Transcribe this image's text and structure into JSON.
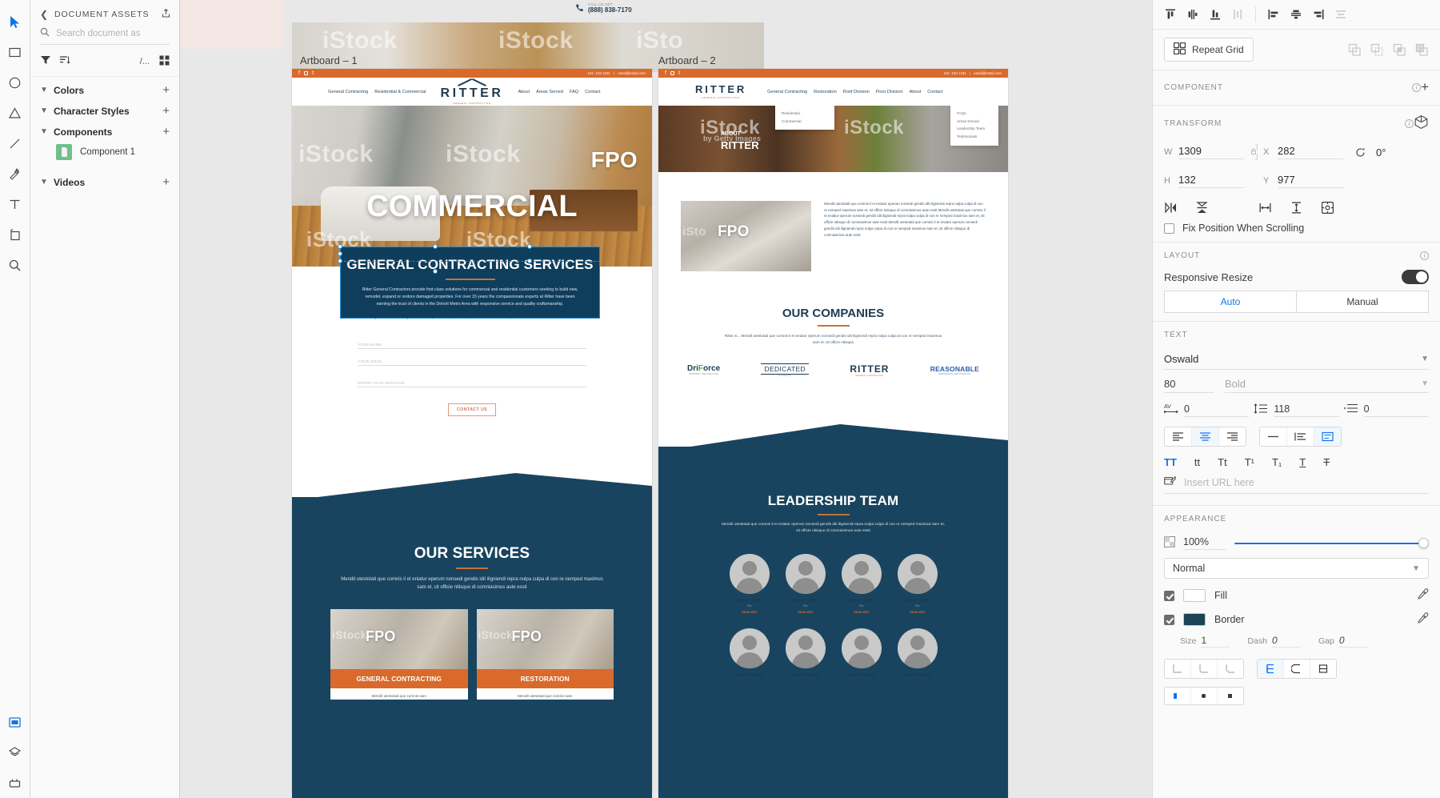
{
  "toolbar": {
    "tools": [
      {
        "name": "select-tool",
        "icon": "cursor-icon",
        "active": true
      },
      {
        "name": "rectangle-tool",
        "icon": "rectangle-icon",
        "active": false
      },
      {
        "name": "ellipse-tool",
        "icon": "ellipse-icon",
        "active": false
      },
      {
        "name": "polygon-tool",
        "icon": "triangle-icon",
        "active": false
      },
      {
        "name": "line-tool",
        "icon": "line-icon",
        "active": false
      },
      {
        "name": "pen-tool",
        "icon": "pen-icon",
        "active": false
      },
      {
        "name": "text-tool",
        "icon": "text-icon",
        "active": false
      },
      {
        "name": "artboard-tool",
        "icon": "artboard-icon",
        "active": false
      },
      {
        "name": "zoom-tool",
        "icon": "magnifier-icon",
        "active": false
      }
    ],
    "bottom": [
      {
        "name": "assets-panel-toggle",
        "icon": "assets-icon",
        "active": true
      },
      {
        "name": "layers-panel-toggle",
        "icon": "layers-icon",
        "active": false
      },
      {
        "name": "plugins-panel-toggle",
        "icon": "plugin-icon",
        "active": false
      }
    ]
  },
  "assets": {
    "title": "DOCUMENT ASSETS",
    "back_icon": "chevron-left-icon",
    "share_icon": "share-icon",
    "search_placeholder": "Search document as",
    "search_value": "",
    "filter_icon": "filter-icon",
    "sort_icon": "sort-icon",
    "view_mode_text": "/...",
    "grid_icon": "grid-view-icon",
    "groups": [
      {
        "label": "Colors",
        "expanded": true,
        "add": "+"
      },
      {
        "label": "Character Styles",
        "expanded": true,
        "add": "+"
      },
      {
        "label": "Components",
        "expanded": true,
        "add": "+"
      },
      {
        "label": "Videos",
        "expanded": true,
        "add": "+"
      }
    ],
    "component_item": "Component 1"
  },
  "canvas": {
    "artboard1": {
      "label": "Artboard – 1",
      "topbar": {
        "phone": "123 -123 1234",
        "sep": "|",
        "email": "email@email.com"
      },
      "nav_left": [
        "General Contracting",
        "Residential & Commercial"
      ],
      "brand": "RITTER",
      "brand_sub": "GENERAL CONTRACTING",
      "nav_right": [
        "About",
        "Areas Served",
        "FAQ",
        "Contact"
      ],
      "hero_title": "COMMERCIAL",
      "selected_box": {
        "title": "GENERAL CONTRACTING SERVICES",
        "body": "Ritter General Contractors provide first-class solutions for commercial and residential customers seeking to build new, remodel, expand or restore damaged properties. For over 15 years the compassionate experts at Ritter have been earning the trust of clients in the Detroit Metro Area with responsive service and quality craftsmanship."
      },
      "form": {
        "intro": "Ritter Contact Us Form Mendit utestotati que comnis il et eniatur eperum nonsedi gendis idit iligniendi repra nulpa culpa di con re nemped maximus sam et, s",
        "fields": [
          "YOUR NAME",
          "YOUR EMAIL",
          "ENTER YOUR MESSAGE"
        ],
        "button": "CONTACT US"
      },
      "services": {
        "title": "OUR SERVICES",
        "body": "Mendit utestotati que comnis il et eniatur eperum nonsedi gendis idit iligniendi repra nulpa culpa di con re nemped maximus sam et, sit officie ntiisquo di comniasimus aute essit",
        "cards": [
          {
            "label": "GENERAL CONTRACTING",
            "blurb": "Mendit utestotati que comnis sam",
            "fpo": "FPO"
          },
          {
            "label": "RESTORATION",
            "blurb": "Mendit utestotati que comnis sam",
            "fpo": "FPO"
          }
        ]
      },
      "fpo": "FPO"
    },
    "artboard2": {
      "label": "Artboard – 2",
      "topbar": {
        "phone": "123 -123 1234",
        "sep": "|",
        "email": "email@email.com"
      },
      "brand": "RITTER",
      "brand_sub": "GENERAL CONTRACTING",
      "nav": [
        "General Contracting",
        "Restoration",
        "Roof Division",
        "Floor Division",
        "About",
        "Contact"
      ],
      "dropdown_left": [
        "Residential",
        "Commercial"
      ],
      "dropdown_right": [
        "FAQs",
        "Areas Served",
        "Leadership Team",
        "Testimonials"
      ],
      "hero_kicker": "ABOUT",
      "hero_title": "RITTER",
      "about_body": "Mendit utestotati que comnis il et eniatur eperum nonsedi gendis idit iligniendi repra nulpa culpa di con re nemped maximus sam et, sit officie ntiisquo di comniasimus aute essit Mendit utestotati que comnis il et eniatur eperum nonsedi gendis idit iligniendi repra nulpa culpa di con re nemped maximus sam et, sit officie ntiisquo di comniasimus aute essit Mendit utestotati que comnis il et eniatur eperum nonsedi gendis idit iligniendi repra nulpa culpa di con re nemped maximus sam et, sit officie ntiisquo di comniasimus aute essit",
      "companies": {
        "title": "OUR COMPANIES",
        "body": "Ritter is... Mendit utestotati que comnis il et eniatur eperum nonsedi gendis idit iligniendi repra nulpa culpa di con re nemped maximus sam et, sit officie ntiisquo",
        "logos": [
          "DriForce",
          "DEDICATED",
          "RITTER",
          "REASONABLE"
        ],
        "logo_subs": [
          "PROPERTY RESTORATION",
          "FLOORING",
          "GENERAL CONTRACTING",
          "REMODELING & RESTORATION"
        ]
      },
      "leadership": {
        "title": "LEADERSHIP TEAM",
        "body": "Mendit utestotati que comnis il et eniatur eperum nonsedi gendis idit iligniendi repra nulpa culpa di con re nemped maximus sam et, sit officie ntiisquo di comniasimus aute essit",
        "members": [
          {
            "name": "NAME NAME",
            "title": "Title",
            "link": "READ BIO"
          },
          {
            "name": "NAME NAME",
            "title": "Title",
            "link": "READ BIO"
          },
          {
            "name": "NAME NAME",
            "title": "Title",
            "link": "READ BIO"
          },
          {
            "name": "NAME NAME",
            "title": "Title",
            "link": "READ BIO"
          },
          {
            "name": "NAME NAME",
            "title": "Title",
            "link": "READ BIO"
          },
          {
            "name": "NAME NAME",
            "title": "Title",
            "link": "READ BIO"
          },
          {
            "name": "NAME NAME",
            "title": "Title",
            "link": "READ BIO"
          },
          {
            "name": "NAME NAME",
            "title": "Title",
            "link": "READ BIO"
          }
        ]
      },
      "fpo": "FPO"
    },
    "top_phone_label": "CALL US 24/7",
    "top_phone": "(888) 838-7170"
  },
  "right_panel": {
    "align": {
      "icons": [
        "align-top-icon",
        "align-vertical-center-icon",
        "align-bottom-icon",
        "distribute-vertical-icon",
        "align-left-icon",
        "align-horizontal-center-icon",
        "align-right-icon",
        "distribute-horizontal-icon"
      ]
    },
    "repeat_grid": {
      "label": "Repeat Grid",
      "icon": "repeat-grid-icon",
      "boolean_ops": [
        "boolean-add-icon",
        "boolean-subtract-icon",
        "boolean-intersect-icon",
        "boolean-exclude-icon"
      ]
    },
    "component": {
      "label": "COMPONENT",
      "add": "+"
    },
    "transform": {
      "label": "TRANSFORM",
      "w_key": "W",
      "w_value": "1309",
      "h_key": "H",
      "h_value": "132",
      "x_key": "X",
      "x_value": "282",
      "y_key": "Y",
      "y_value": "977",
      "rotation": "0°",
      "lock_icon": "lock-icon",
      "flip_icons": [
        "flip-horizontal-icon",
        "flip-vertical-icon"
      ],
      "resize_icons": [
        "fit-width-icon",
        "fit-height-icon",
        "fit-both-icon"
      ],
      "three_d_icon": "3d-transform-icon"
    },
    "fix_position": {
      "label": "Fix Position When Scrolling",
      "checked": false
    },
    "layout": {
      "label": "LAYOUT",
      "responsive_label": "Responsive Resize",
      "responsive_on": true,
      "auto": "Auto",
      "manual": "Manual",
      "selected": "Auto"
    },
    "text": {
      "label": "TEXT",
      "font_family": "Oswald",
      "font_size": "80",
      "font_weight": "Bold",
      "letter_spacing_icon": "letter-spacing-icon",
      "letter_spacing": "0",
      "line_height_icon": "line-height-icon",
      "line_height": "118",
      "paragraph_spacing_icon": "paragraph-spacing-icon",
      "paragraph_spacing": "0",
      "align_icons": [
        "text-align-left-icon",
        "text-align-center-icon",
        "text-align-right-icon"
      ],
      "align_selected": "text-align-center-icon",
      "autosize_icons": [
        "auto-width-icon",
        "auto-height-icon",
        "fixed-size-icon"
      ],
      "autosize_selected": "fixed-size-icon",
      "case_icons": [
        "uppercase-icon",
        "lowercase-icon",
        "titlecase-icon",
        "superscript-icon",
        "subscript-icon",
        "underline-icon",
        "strikethrough-icon"
      ],
      "case_selected": "uppercase-icon",
      "url_icon": "link-icon",
      "url_placeholder": "Insert URL here",
      "url_value": ""
    },
    "appearance": {
      "label": "APPEARANCE",
      "opacity_icon": "opacity-icon",
      "opacity": "100%",
      "blend_mode": "Normal",
      "fill": {
        "label": "Fill",
        "checked": true,
        "color": "#ffffff",
        "eyedropper": "eyedropper-icon"
      },
      "border": {
        "label": "Border",
        "checked": true,
        "color": "#1d4358",
        "eyedropper": "eyedropper-icon"
      },
      "border_size": {
        "key": "Size",
        "value": "1"
      },
      "border_dash": {
        "key": "Dash",
        "value": "0"
      },
      "border_gap": {
        "key": "Gap",
        "value": "0"
      },
      "join_icons": [
        "miter-join-icon",
        "round-join-icon",
        "bevel-join-icon"
      ],
      "align_icons": [
        "border-center-icon",
        "border-inner-icon",
        "border-outer-icon"
      ],
      "align_selected": "border-center-icon",
      "cap_icons": [
        "butt-cap-icon",
        "round-cap-icon",
        "square-cap-icon"
      ]
    }
  }
}
